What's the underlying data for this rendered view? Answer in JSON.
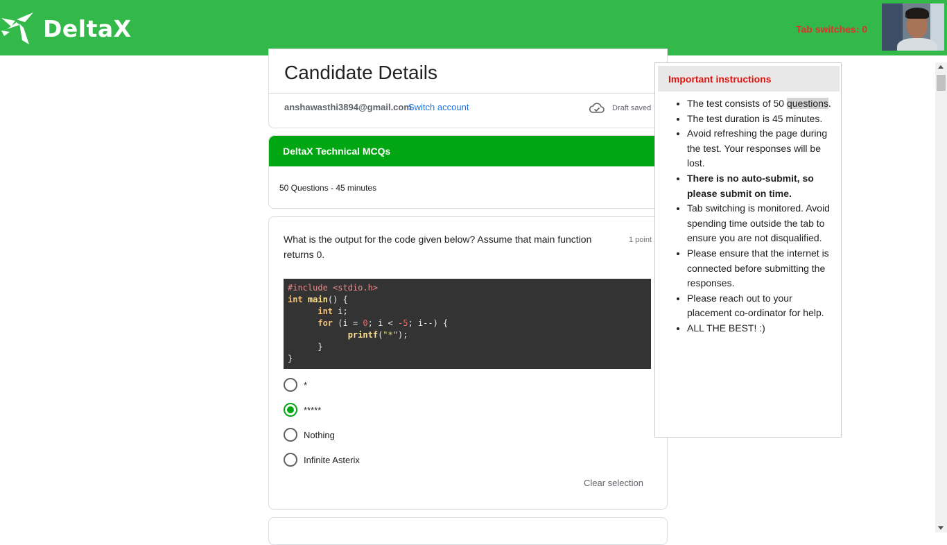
{
  "header": {
    "logo_text": "DeltaX",
    "tab_switches": "Tab switches: 0",
    "bg_color": "#33b84a"
  },
  "candidate": {
    "title": "Candidate Details",
    "email": "anshawasthi3894@gmail.com",
    "switch_account": "Switch account",
    "draft_status": "Draft saved",
    "draft_icon": "cloud-check-icon"
  },
  "quiz": {
    "title": "DeltaX Technical MCQs",
    "description": "50 Questions - 45 minutes",
    "accent_color": "#00a712"
  },
  "question": {
    "text": "What is the output for the code given below? Assume that main function returns 0.",
    "points": "1 point",
    "code_lines": [
      "#include <stdio.h>",
      "int main() {",
      "      int i;",
      "      for (i = 0; i < -5; i--) {",
      "            printf(\"*\");",
      "      }",
      "}"
    ],
    "options": [
      {
        "label": "*",
        "selected": false
      },
      {
        "label": "*****",
        "selected": true
      },
      {
        "label": "Nothing",
        "selected": false
      },
      {
        "label": "Infinite Asterix",
        "selected": false
      }
    ],
    "clear_selection": "Clear selection"
  },
  "instructions": {
    "title": "Important instructions",
    "items": [
      "The test consists of 50 questions.",
      "The test duration is 45 minutes.",
      "Avoid refreshing the page during the test. Your responses will be lost.",
      "There is no auto-submit, so please submit on time.",
      "Tab switching is monitored. Avoid spending time outside the tab to ensure you are not disqualified.",
      "Please ensure that the internet is connected before submitting the responses.",
      "Please reach out to your placement co-ordinator for help.",
      "ALL THE BEST! :)"
    ],
    "title_color": "#e0120e"
  }
}
